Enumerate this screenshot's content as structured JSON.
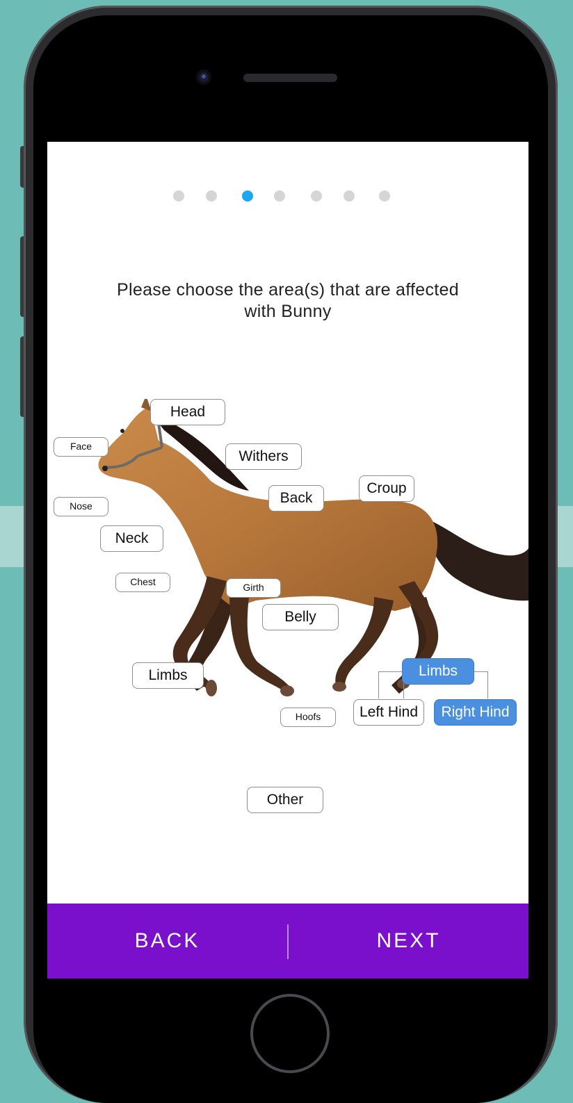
{
  "progress": {
    "total_steps": 7,
    "current_step": 3
  },
  "question": {
    "line1": "Please choose the area(s) that are affected",
    "line2": "with Bunny"
  },
  "tags": {
    "head": "Head",
    "face": "Face",
    "withers": "Withers",
    "nose": "Nose",
    "back": "Back",
    "croup": "Croup",
    "neck": "Neck",
    "chest": "Chest",
    "girth": "Girth",
    "belly": "Belly",
    "limbs_front": "Limbs",
    "limbs_hind": "Limbs",
    "hoofs": "Hoofs",
    "left_hind": "Left Hind",
    "right_hind": "Right Hind",
    "other": "Other"
  },
  "selected": [
    "limbs_hind",
    "right_hind"
  ],
  "footer": {
    "back_label": "BACK",
    "next_label": "NEXT"
  },
  "colors": {
    "accent": "#7a0fcc",
    "selected": "#4a8fe0",
    "active_dot": "#1fa6f0",
    "background": "#6dbdb6"
  }
}
